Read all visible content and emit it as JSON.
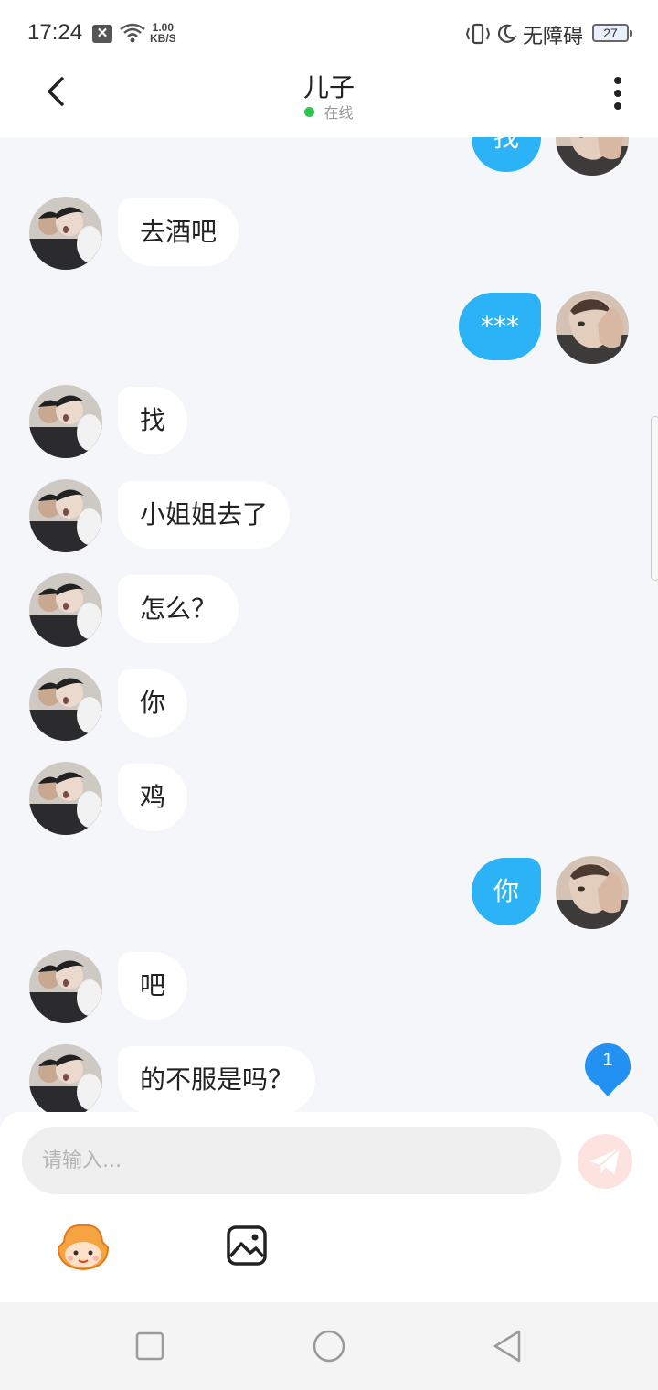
{
  "status_bar": {
    "time": "17:24",
    "notification_x": "✕",
    "net_speed_value": "1.00",
    "net_speed_unit": "KB/S",
    "accessibility_label": "无障碍",
    "battery": "27"
  },
  "header": {
    "title": "儿子",
    "status": "在线"
  },
  "messages": [
    {
      "side": "right",
      "text": "找"
    },
    {
      "side": "left",
      "text": "去酒吧"
    },
    {
      "side": "right",
      "text": "***"
    },
    {
      "side": "left",
      "text": "找"
    },
    {
      "side": "left",
      "text": "小姐姐去了"
    },
    {
      "side": "left",
      "text": "怎么？"
    },
    {
      "side": "left",
      "text": "你"
    },
    {
      "side": "left",
      "text": "鸡"
    },
    {
      "side": "right",
      "text": "你"
    },
    {
      "side": "left",
      "text": "吧"
    },
    {
      "side": "left",
      "text": "的不服是吗？"
    }
  ],
  "unread": {
    "count": "1"
  },
  "composer": {
    "placeholder": "请输入...",
    "value": ""
  },
  "icons": {
    "back": "chevron-left-icon",
    "more": "more-vertical-icon",
    "send": "send-icon",
    "emoji": "emoji-mascot-icon",
    "image": "image-icon"
  },
  "colors": {
    "accent_blue": "#2bb2f7",
    "online_green": "#2bc84d",
    "chat_background": "#f4f6f9",
    "send_button": "#fde3e0"
  }
}
